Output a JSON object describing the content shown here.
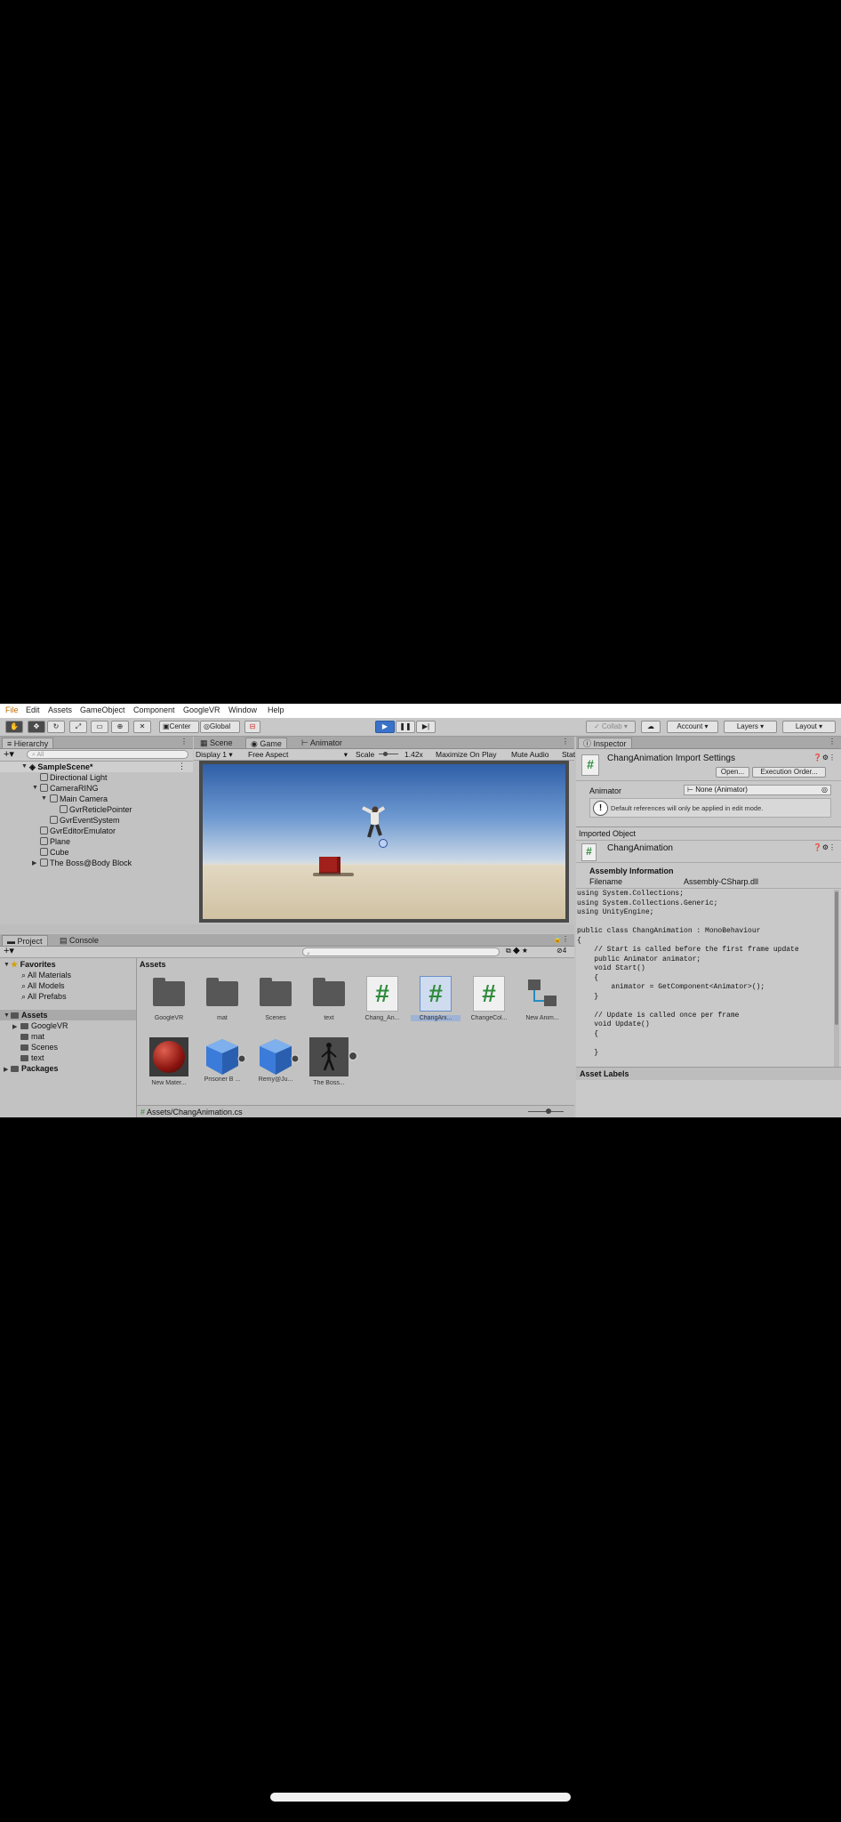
{
  "menu": [
    "File",
    "Edit",
    "Assets",
    "GameObject",
    "Component",
    "GoogleVR",
    "Window",
    "Help"
  ],
  "toolbar": {
    "pivot_center": "Center",
    "pivot_global": "Global",
    "collab": "Collab",
    "account": "Account",
    "layers": "Layers",
    "layout": "Layout"
  },
  "hierarchy": {
    "tab": "Hierarchy",
    "search_placeholder": "All",
    "items": [
      {
        "label": "SampleScene*",
        "depth": 0
      },
      {
        "label": "Directional Light",
        "depth": 1
      },
      {
        "label": "CameraRING",
        "depth": 1
      },
      {
        "label": "Main Camera",
        "depth": 2
      },
      {
        "label": "GvrReticlePointer",
        "depth": 3
      },
      {
        "label": "GvrEventSystem",
        "depth": 2
      },
      {
        "label": "GvrEditorEmulator",
        "depth": 1
      },
      {
        "label": "Plane",
        "depth": 1
      },
      {
        "label": "Cube",
        "depth": 1
      },
      {
        "label": "The Boss@Body Block",
        "depth": 1
      }
    ]
  },
  "center": {
    "tabs": [
      "Scene",
      "Game",
      "Animator"
    ],
    "display": "Display 1",
    "aspect": "Free Aspect",
    "scale_label": "Scale",
    "scale_value": "1.42x",
    "maximize": "Maximize On Play",
    "mute": "Mute Audio",
    "stats": "Stat"
  },
  "inspector": {
    "tab": "Inspector",
    "title": "ChangAnimation Import Settings",
    "open": "Open...",
    "execution_order": "Execution Order...",
    "animator_label": "Animator",
    "animator_value": "None (Animator)",
    "info": "Default references will only be applied in edit mode.",
    "imported_object": "Imported Object",
    "object_name": "ChangAnimation",
    "assembly_heading": "Assembly Information",
    "filename_label": "Filename",
    "filename_value": "Assembly-CSharp.dll",
    "code": [
      "using System.Collections;",
      "using System.Collections.Generic;",
      "using UnityEngine;",
      "",
      "public class ChangAnimation : MonoBehaviour",
      "{",
      "    // Start is called before the first frame update",
      "    public Animator animator;",
      "    void Start()",
      "    {",
      "        animator = GetComponent<Animator>();",
      "    }",
      "",
      "    // Update is called once per frame",
      "    void Update()",
      "    {",
      "",
      "    }"
    ],
    "asset_labels": "Asset Labels"
  },
  "project": {
    "tabs": [
      "Project",
      "Console"
    ],
    "favorites_label": "Favorites",
    "favorites": [
      "All Materials",
      "All Models",
      "All Prefabs"
    ],
    "assets_label": "Assets",
    "asset_folders": [
      "GoogleVR",
      "mat",
      "Scenes",
      "text"
    ],
    "packages_label": "Packages",
    "breadcrumb": "Assets",
    "hidden_count": "4",
    "grid": [
      {
        "label": "GoogleVR",
        "kind": "folder"
      },
      {
        "label": "mat",
        "kind": "folder"
      },
      {
        "label": "Scenes",
        "kind": "folder"
      },
      {
        "label": "text",
        "kind": "folder"
      },
      {
        "label": "Chang_An...",
        "kind": "script"
      },
      {
        "label": "ChangAni...",
        "kind": "script"
      },
      {
        "label": "ChangeCol...",
        "kind": "script"
      },
      {
        "label": "New Anim...",
        "kind": "animator"
      },
      {
        "label": "New Mater...",
        "kind": "material"
      },
      {
        "label": "Prisoner B ...",
        "kind": "model"
      },
      {
        "label": "Remy@Ju...",
        "kind": "model"
      },
      {
        "label": "The Boss...",
        "kind": "avatar"
      }
    ],
    "status_path": "Assets/ChangAnimation.cs"
  }
}
